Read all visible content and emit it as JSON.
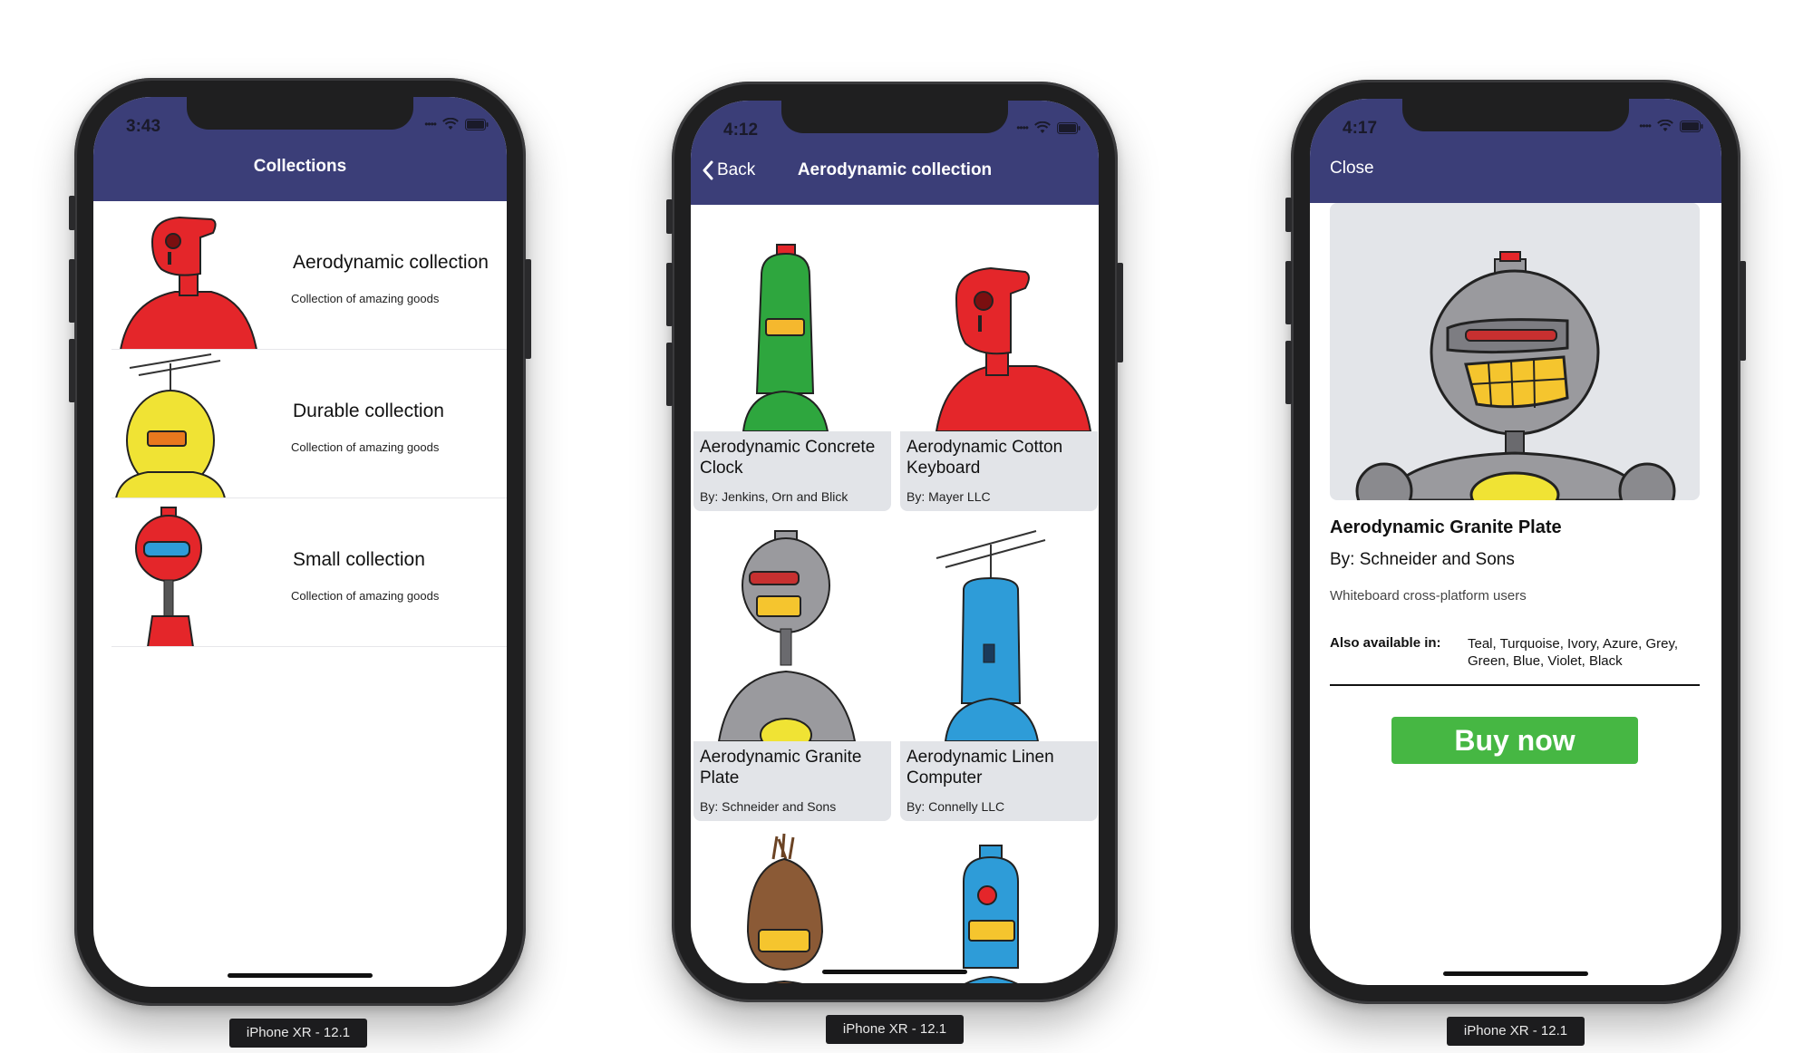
{
  "device_label": "iPhone XR - 12.1",
  "status_icons": [
    "signal-icon",
    "wifi-icon",
    "battery-icon"
  ],
  "screen1": {
    "time": "3:43",
    "title": "Collections",
    "items": [
      {
        "title": "Aerodynamic collection",
        "subtitle": "Collection of amazing goods",
        "robot_color": "#e4262a"
      },
      {
        "title": "Durable collection",
        "subtitle": "Collection of amazing goods",
        "robot_color": "#f0e334"
      },
      {
        "title": "Small collection",
        "subtitle": "Collection of amazing goods",
        "robot_color": "#e4262a"
      }
    ]
  },
  "screen2": {
    "time": "4:12",
    "back_label": "Back",
    "title": "Aerodynamic collection",
    "products": [
      {
        "name": "Aerodynamic Concrete Clock",
        "by": "By: Jenkins, Orn and Blick",
        "robot_color": "#2ea63e"
      },
      {
        "name": "Aerodynamic Cotton Keyboard",
        "by": "By: Mayer LLC",
        "robot_color": "#e4262a"
      },
      {
        "name": "Aerodynamic Granite Plate",
        "by": "By: Schneider and Sons",
        "robot_color": "#9a9a9e"
      },
      {
        "name": "Aerodynamic Linen Computer",
        "by": "By: Connelly LLC",
        "robot_color": "#2e9cd8"
      },
      {
        "robot_color": "#8b5a36"
      },
      {
        "robot_color": "#2e9cd8"
      }
    ]
  },
  "screen3": {
    "time": "4:17",
    "close_label": "Close",
    "product_name": "Aerodynamic Granite Plate",
    "by": "By: Schneider and Sons",
    "description": "Whiteboard cross-platform users",
    "available_label": "Also available in:",
    "available_values": "Teal, Turquoise, Ivory, Azure, Grey, Green, Blue, Violet, Black",
    "buy_label": "Buy now",
    "buy_color": "#46b743",
    "robot_color": "#9a9a9e"
  },
  "nav_color": "#3b3e78"
}
